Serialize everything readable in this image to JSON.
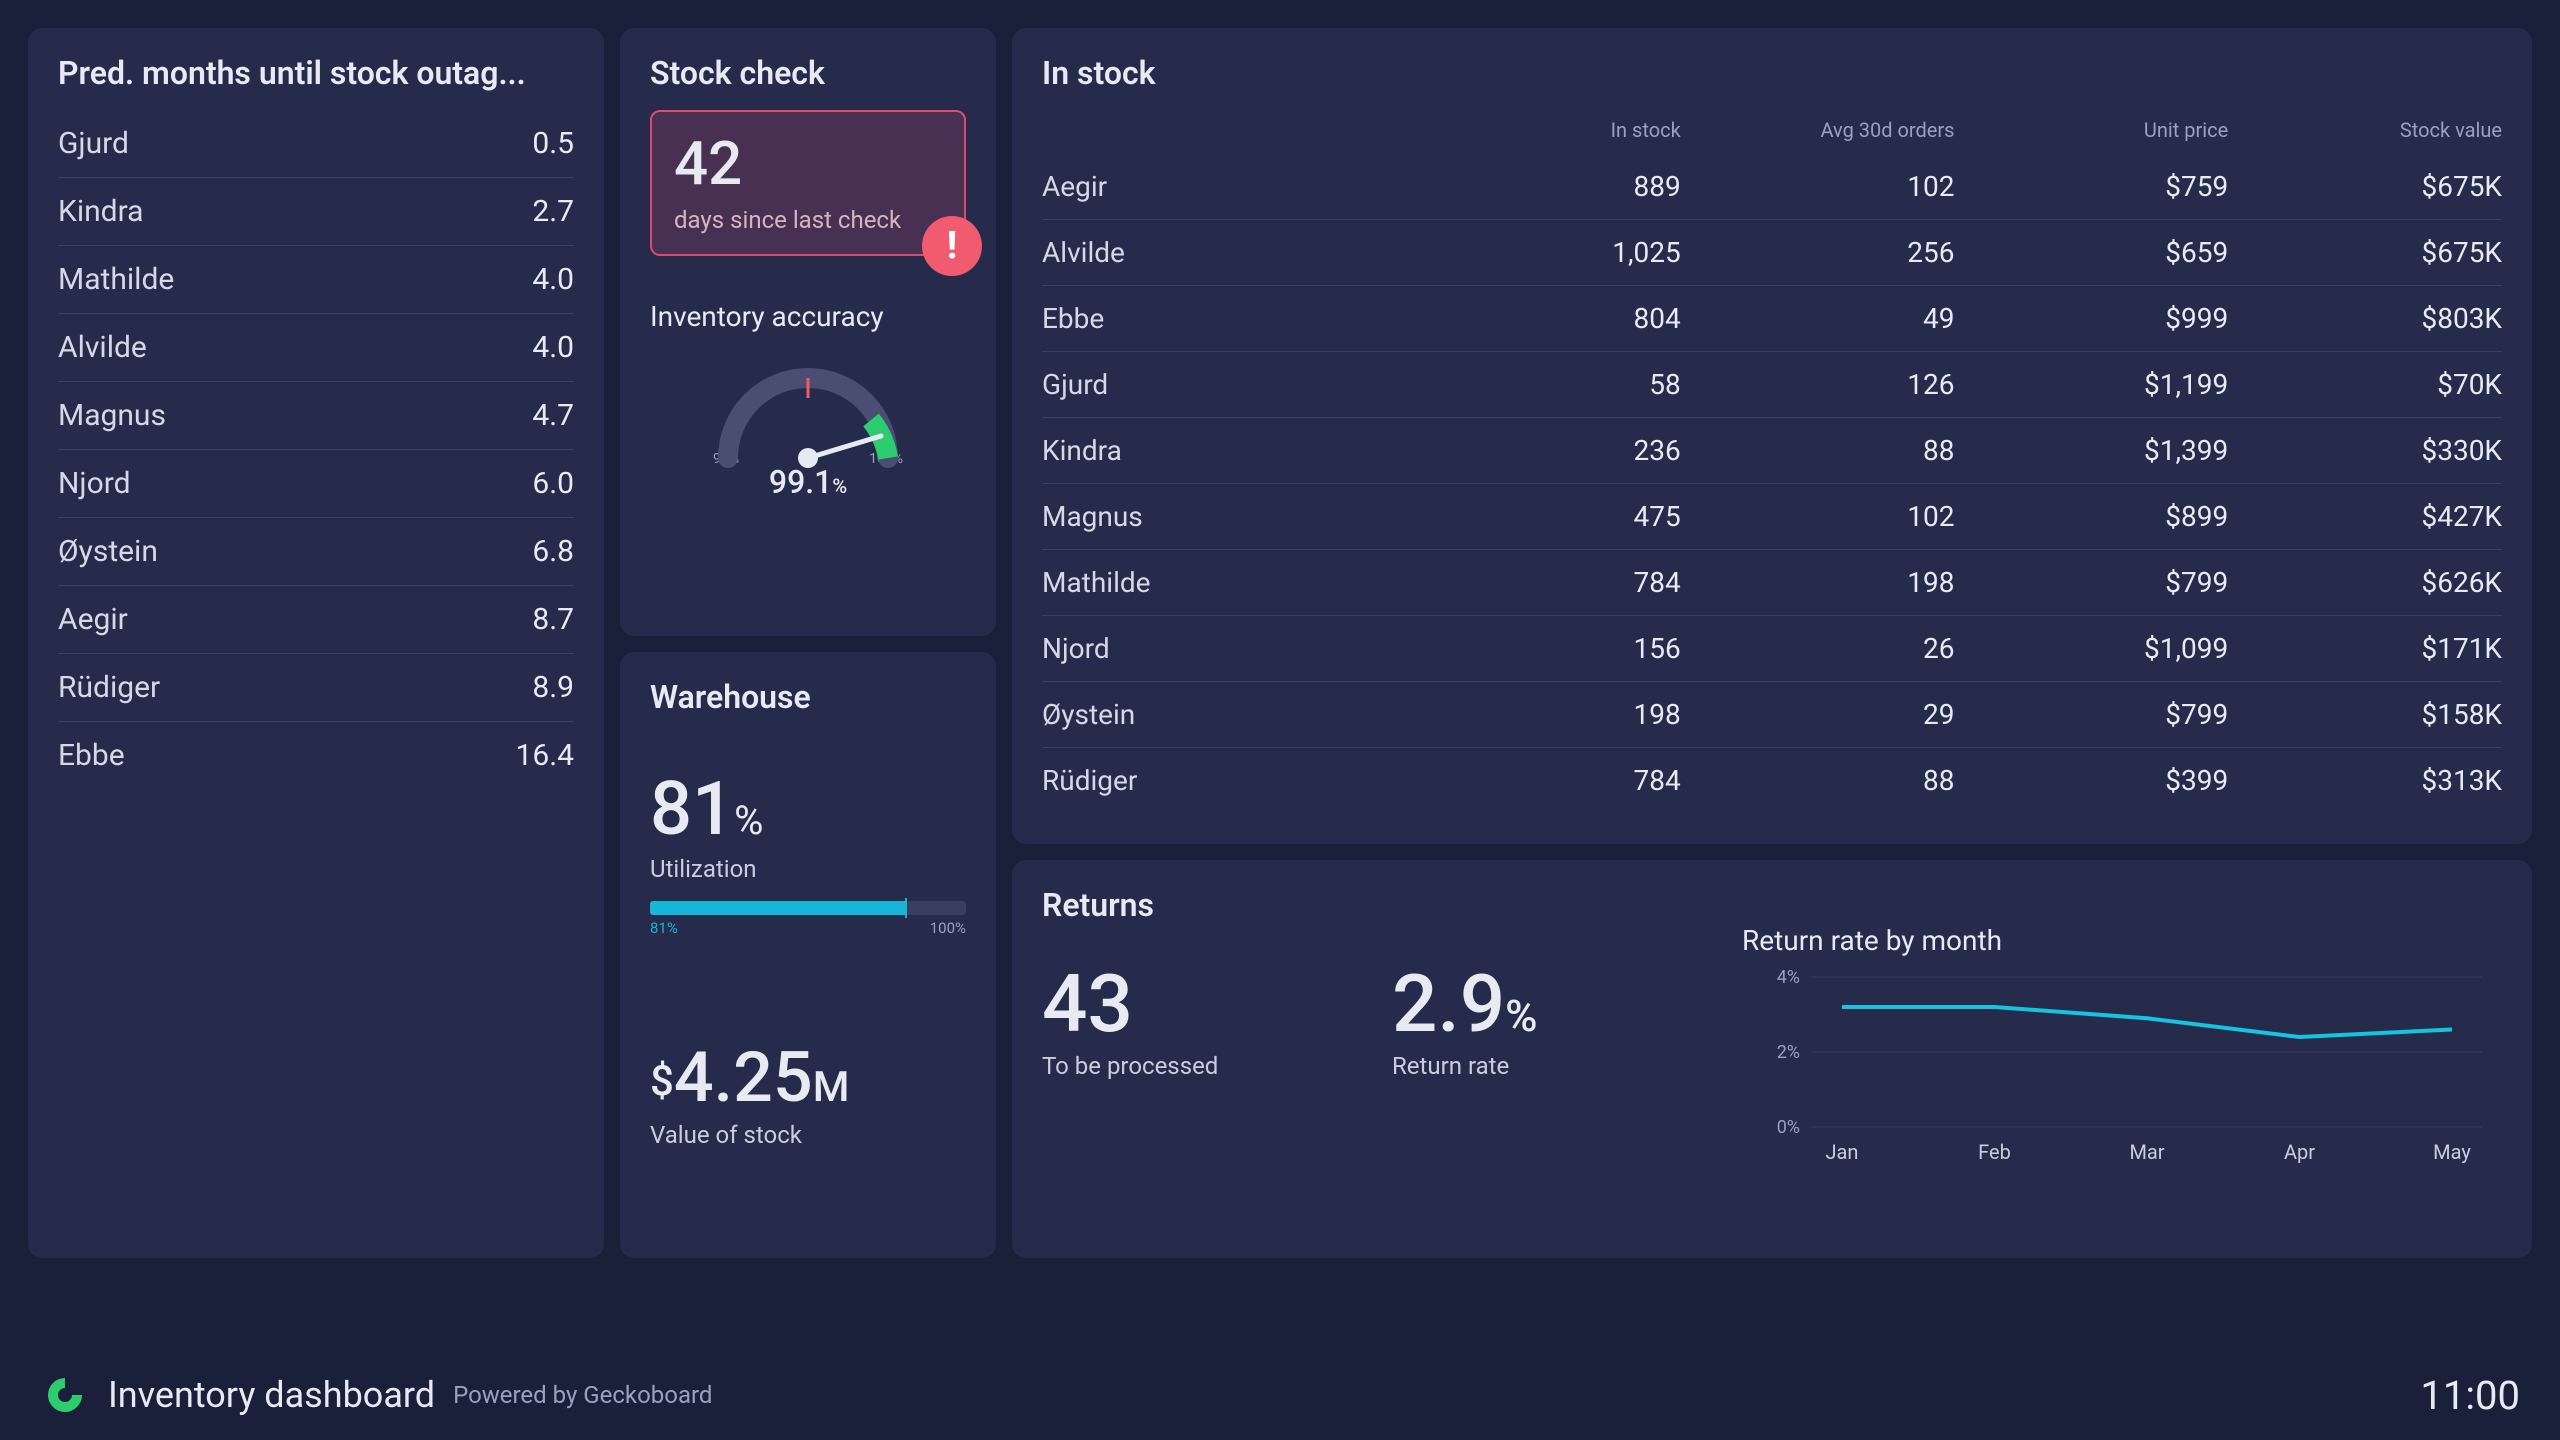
{
  "outage": {
    "title": "Pred. months until stock outag...",
    "rows": [
      {
        "name": "Gjurd",
        "value": "0.5"
      },
      {
        "name": "Kindra",
        "value": "2.7"
      },
      {
        "name": "Mathilde",
        "value": "4.0"
      },
      {
        "name": "Alvilde",
        "value": "4.0"
      },
      {
        "name": "Magnus",
        "value": "4.7"
      },
      {
        "name": "Njord",
        "value": "6.0"
      },
      {
        "name": "Øystein",
        "value": "6.8"
      },
      {
        "name": "Aegir",
        "value": "8.7"
      },
      {
        "name": "Rüdiger",
        "value": "8.9"
      },
      {
        "name": "Ebbe",
        "value": "16.4"
      }
    ]
  },
  "stockcheck": {
    "title": "Stock check",
    "days": "42",
    "days_label": "days since last check",
    "alert_glyph": "!",
    "accuracy_title": "Inventory accuracy",
    "gauge_min": "90%",
    "gauge_max": "100%",
    "accuracy_value": "99.1",
    "accuracy_unit": "%"
  },
  "warehouse": {
    "title": "Warehouse",
    "util_value": "81",
    "util_unit": "%",
    "util_label": "Utilization",
    "bar_left": "81%",
    "bar_right": "100%",
    "value_prefix": "$",
    "value_main": "4.25",
    "value_suffix": "M",
    "value_label": "Value of stock"
  },
  "instock": {
    "title": "In stock",
    "headers": {
      "c1": "In stock",
      "c2": "Avg 30d orders",
      "c3": "Unit price",
      "c4": "Stock value"
    },
    "rows": [
      {
        "name": "Aegir",
        "stock": "889",
        "orders": "102",
        "price": "$759",
        "value": "$675K"
      },
      {
        "name": "Alvilde",
        "stock": "1,025",
        "orders": "256",
        "price": "$659",
        "value": "$675K"
      },
      {
        "name": "Ebbe",
        "stock": "804",
        "orders": "49",
        "price": "$999",
        "value": "$803K"
      },
      {
        "name": "Gjurd",
        "stock": "58",
        "orders": "126",
        "price": "$1,199",
        "value": "$70K"
      },
      {
        "name": "Kindra",
        "stock": "236",
        "orders": "88",
        "price": "$1,399",
        "value": "$330K"
      },
      {
        "name": "Magnus",
        "stock": "475",
        "orders": "102",
        "price": "$899",
        "value": "$427K"
      },
      {
        "name": "Mathilde",
        "stock": "784",
        "orders": "198",
        "price": "$799",
        "value": "$626K"
      },
      {
        "name": "Njord",
        "stock": "156",
        "orders": "26",
        "price": "$1,099",
        "value": "$171K"
      },
      {
        "name": "Øystein",
        "stock": "198",
        "orders": "29",
        "price": "$799",
        "value": "$158K"
      },
      {
        "name": "Rüdiger",
        "stock": "784",
        "orders": "88",
        "price": "$399",
        "value": "$313K"
      }
    ]
  },
  "returns": {
    "title": "Returns",
    "to_process": "43",
    "to_process_label": "To be processed",
    "rate": "2.9",
    "rate_unit": "%",
    "rate_label": "Return rate"
  },
  "chart_data": {
    "type": "line",
    "title": "Return rate by month",
    "categories": [
      "Jan",
      "Feb",
      "Mar",
      "Apr",
      "May"
    ],
    "values": [
      3.2,
      3.2,
      2.9,
      2.4,
      2.6
    ],
    "ylabel": "",
    "ylim": [
      0,
      4
    ],
    "yticks": [
      "0%",
      "2%",
      "4%"
    ]
  },
  "footer": {
    "title": "Inventory dashboard",
    "subtitle": "Powered by Geckoboard",
    "clock": "11:00"
  }
}
